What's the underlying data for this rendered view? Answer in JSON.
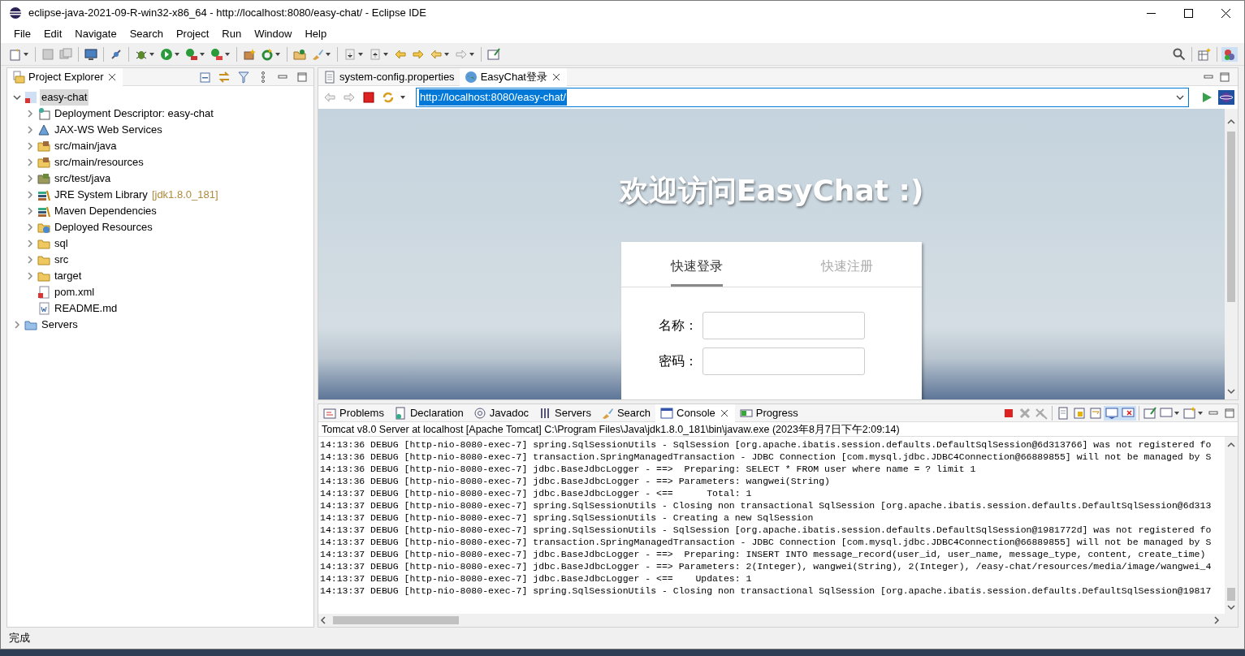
{
  "window": {
    "title": "eclipse-java-2021-09-R-win32-x86_64 - http://localhost:8080/easy-chat/ - Eclipse IDE"
  },
  "menu": [
    "File",
    "Edit",
    "Navigate",
    "Search",
    "Project",
    "Run",
    "Window",
    "Help"
  ],
  "project_explorer": {
    "title": "Project Explorer",
    "tree": [
      {
        "label": "easy-chat",
        "kind": "node",
        "expanded": true,
        "selected": true,
        "children": [
          {
            "label": "Deployment Descriptor: easy-chat",
            "kind": "node",
            "expanded": false,
            "selected": false
          },
          {
            "label": "JAX-WS Web Services",
            "kind": "node",
            "expanded": false,
            "selected": false
          },
          {
            "label": "src/main/java",
            "kind": "node",
            "expanded": false,
            "selected": false
          },
          {
            "label": "src/main/resources",
            "kind": "node",
            "expanded": false,
            "selected": false
          },
          {
            "label": "src/test/java",
            "kind": "node",
            "expanded": false,
            "selected": false
          },
          {
            "label": "JRE System Library",
            "decoration": "[jdk1.8.0_181]",
            "kind": "node",
            "expanded": false,
            "selected": false
          },
          {
            "label": "Maven Dependencies",
            "kind": "node",
            "expanded": false,
            "selected": false
          },
          {
            "label": "Deployed Resources",
            "kind": "node",
            "expanded": false,
            "selected": false
          },
          {
            "label": "sql",
            "kind": "node",
            "expanded": false,
            "selected": false
          },
          {
            "label": "src",
            "kind": "node",
            "expanded": false,
            "selected": false
          },
          {
            "label": "target",
            "kind": "node",
            "expanded": false,
            "selected": false
          },
          {
            "label": "pom.xml",
            "kind": "leaf",
            "selected": false
          },
          {
            "label": "README.md",
            "kind": "leaf",
            "selected": false
          }
        ]
      },
      {
        "label": "Servers",
        "kind": "node",
        "expanded": false,
        "selected": false
      }
    ]
  },
  "editor_tabs": [
    {
      "label": "system-config.properties",
      "selected": false
    },
    {
      "label": "EasyChat登录",
      "selected": true
    }
  ],
  "address_bar": {
    "value": "http://localhost:8080/easy-chat/"
  },
  "web_page": {
    "heading": "欢迎访问EasyChat :)",
    "login_tabs": [
      {
        "label": "快速登录",
        "selected": true
      },
      {
        "label": "快速注册",
        "selected": false
      }
    ],
    "fields": [
      {
        "label": "名称："
      },
      {
        "label": "密码："
      }
    ]
  },
  "bottom_tabs": [
    {
      "label": "Problems",
      "selected": false
    },
    {
      "label": "Declaration",
      "selected": false
    },
    {
      "label": "Javadoc",
      "selected": false
    },
    {
      "label": "Servers",
      "selected": false
    },
    {
      "label": "Search",
      "selected": false
    },
    {
      "label": "Console",
      "selected": true
    },
    {
      "label": "Progress",
      "selected": false
    }
  ],
  "console": {
    "header": "Tomcat v8.0 Server at localhost [Apache Tomcat] C:\\Program Files\\Java\\jdk1.8.0_181\\bin\\javaw.exe  (2023年8月7日下午2:09:14)",
    "lines": [
      "14:13:36 DEBUG [http-nio-8080-exec-7] spring.SqlSessionUtils - SqlSession [org.apache.ibatis.session.defaults.DefaultSqlSession@6d313766] was not registered fo",
      "14:13:36 DEBUG [http-nio-8080-exec-7] transaction.SpringManagedTransaction - JDBC Connection [com.mysql.jdbc.JDBC4Connection@66889855] will not be managed by S",
      "14:13:36 DEBUG [http-nio-8080-exec-7] jdbc.BaseJdbcLogger - ==>  Preparing: SELECT * FROM user where name = ? limit 1",
      "14:13:36 DEBUG [http-nio-8080-exec-7] jdbc.BaseJdbcLogger - ==> Parameters: wangwei(String)",
      "14:13:37 DEBUG [http-nio-8080-exec-7] jdbc.BaseJdbcLogger - <==      Total: 1",
      "14:13:37 DEBUG [http-nio-8080-exec-7] spring.SqlSessionUtils - Closing non transactional SqlSession [org.apache.ibatis.session.defaults.DefaultSqlSession@6d313",
      "14:13:37 DEBUG [http-nio-8080-exec-7] spring.SqlSessionUtils - Creating a new SqlSession",
      "14:13:37 DEBUG [http-nio-8080-exec-7] spring.SqlSessionUtils - SqlSession [org.apache.ibatis.session.defaults.DefaultSqlSession@1981772d] was not registered fo",
      "14:13:37 DEBUG [http-nio-8080-exec-7] transaction.SpringManagedTransaction - JDBC Connection [com.mysql.jdbc.JDBC4Connection@66889855] will not be managed by S",
      "14:13:37 DEBUG [http-nio-8080-exec-7] jdbc.BaseJdbcLogger - ==>  Preparing: INSERT INTO message_record(user_id, user_name, message_type, content, create_time)",
      "14:13:37 DEBUG [http-nio-8080-exec-7] jdbc.BaseJdbcLogger - ==> Parameters: 2(Integer), wangwei(String), 2(Integer), /easy-chat/resources/media/image/wangwei_4",
      "14:13:37 DEBUG [http-nio-8080-exec-7] jdbc.BaseJdbcLogger - <==    Updates: 1",
      "14:13:37 DEBUG [http-nio-8080-exec-7] spring.SqlSessionUtils - Closing non transactional SqlSession [org.apache.ibatis.session.defaults.DefaultSqlSession@19817"
    ]
  },
  "status_bar": {
    "text": "完成"
  }
}
